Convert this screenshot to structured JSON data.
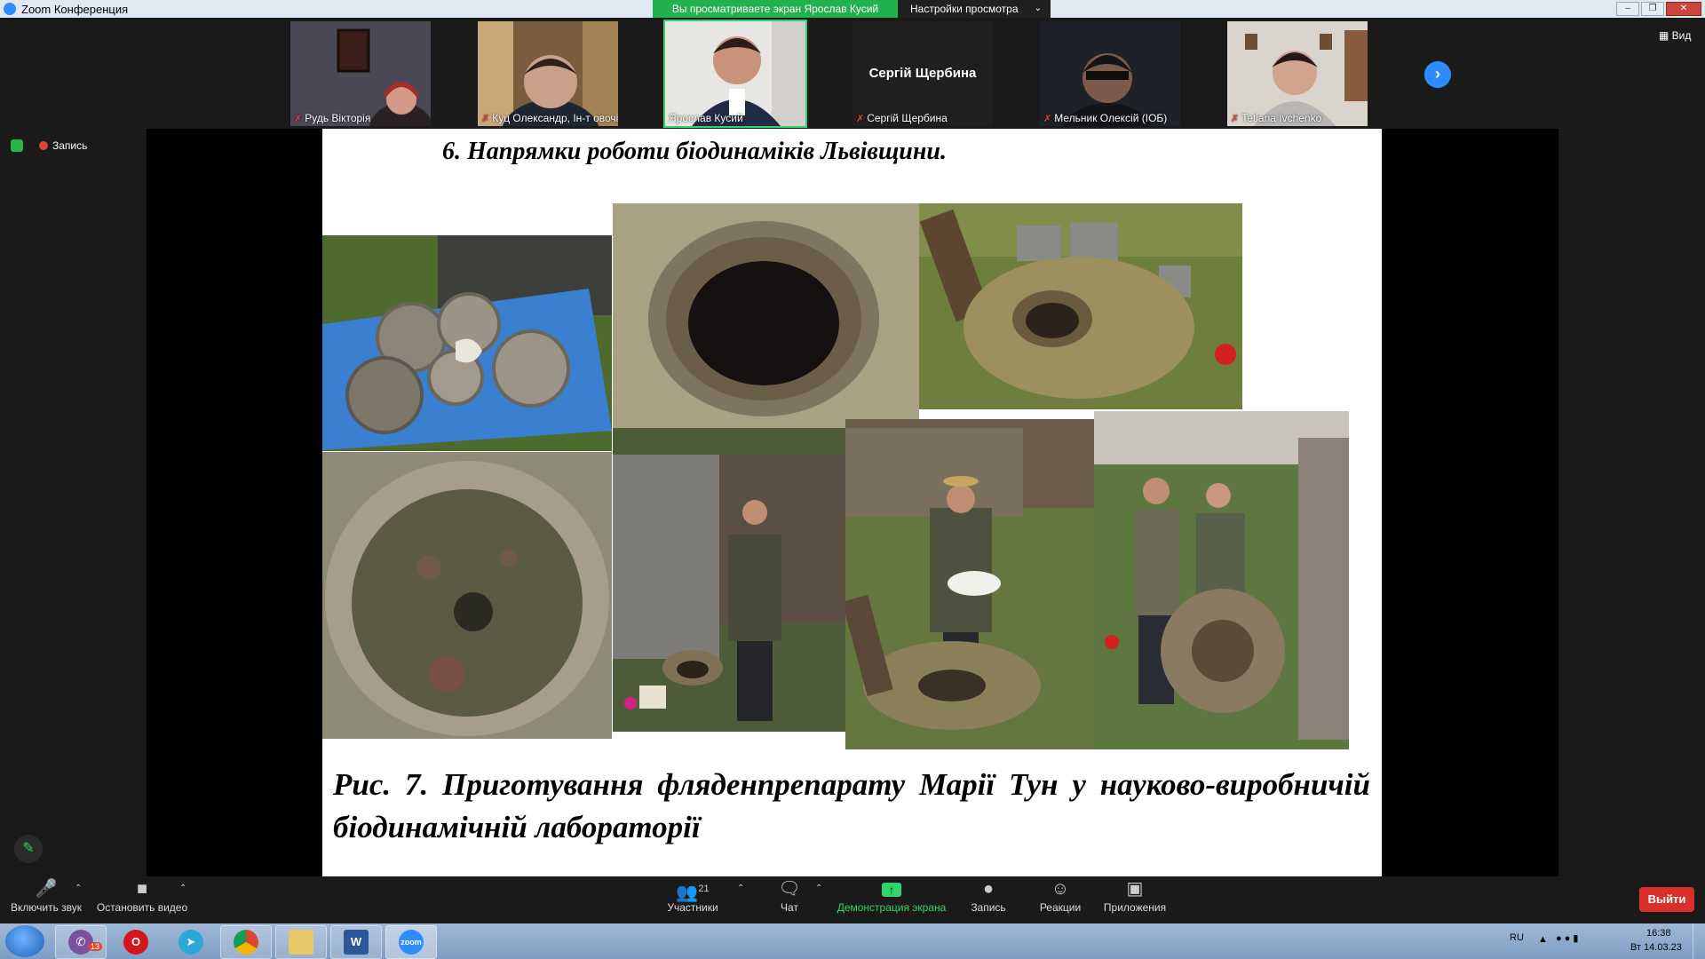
{
  "window": {
    "title": "Zoom Конференция"
  },
  "share_banner": {
    "text": "Вы просматриваете экран Ярослав Кусий"
  },
  "view_options": {
    "label": "Настройки просмотра"
  },
  "participants_strip": [
    {
      "name": "Рудь Вікторія",
      "muted": true,
      "video": true
    },
    {
      "name": "Куц Олександр, Ін-т овочівн...",
      "muted": true,
      "video": true
    },
    {
      "name": "Ярослав Кусий",
      "muted": false,
      "video": true,
      "active": true
    },
    {
      "name": "Сергій Щербина",
      "muted": true,
      "video": false,
      "display_name": "Сергій Щербина"
    },
    {
      "name": "Мельник Олексій (ІОБ)",
      "muted": true,
      "video": true
    },
    {
      "name": "Tetiana Ivchenko",
      "muted": true,
      "video": true
    }
  ],
  "view_button": {
    "label": "Вид"
  },
  "recording": {
    "label": "Запись"
  },
  "slide": {
    "heading": "6. Напрямки роботи біодинаміків Львівщини.",
    "caption": "Рис. 7. Приготування фляденпрепарату Марії Тун у науково-виробничій біодинамічній лабораторії"
  },
  "toolbar": {
    "unmute": "Включить звук",
    "stop_video": "Остановить видео",
    "participants": "Участники",
    "participants_count": "21",
    "chat": "Чат",
    "share_screen": "Демонстрация экрана",
    "record": "Запись",
    "reactions": "Реакции",
    "apps": "Приложения",
    "leave": "Выйти"
  },
  "taskbar": {
    "viber_badge": "13",
    "lang": "RU",
    "time": "16:38",
    "date": "Вт 14.03.23"
  },
  "colors": {
    "share_banner": "#22b14c",
    "accent": "#2d8cff",
    "leave": "#d9302c"
  }
}
